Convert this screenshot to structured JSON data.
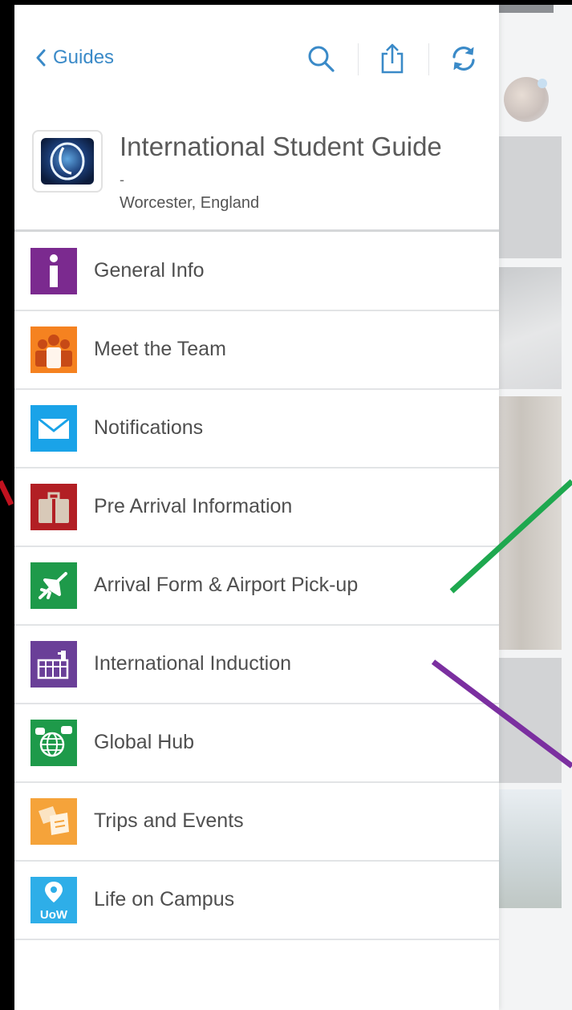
{
  "toolbar": {
    "back_label": "Guides",
    "search_icon": "search-icon",
    "share_icon": "share-icon",
    "refresh_icon": "refresh-icon",
    "accent_color": "#3a8ac8"
  },
  "guide": {
    "title": "International Student Guide",
    "dash": "-",
    "location": "Worcester, England"
  },
  "menu": {
    "items": [
      {
        "label": "General Info",
        "icon": "info-icon",
        "color": "#7b2a8f"
      },
      {
        "label": "Meet the Team",
        "icon": "team-icon",
        "color": "#f58220"
      },
      {
        "label": "Notifications",
        "icon": "mail-icon",
        "color": "#1aa3e8"
      },
      {
        "label": "Pre Arrival Information",
        "icon": "suitcase-icon",
        "color": "#b21f24"
      },
      {
        "label": "Arrival Form & Airport Pick-up",
        "icon": "airplane-icon",
        "color": "#1e9a4a"
      },
      {
        "label": "International Induction",
        "icon": "building-icon",
        "color": "#6a3f98"
      },
      {
        "label": "Global Hub",
        "icon": "globe-chat-icon",
        "color": "#1e9a4a"
      },
      {
        "label": "Trips and Events",
        "icon": "tickets-icon",
        "color": "#f5a33a"
      },
      {
        "label": "Life on Campus",
        "icon": "campus-pin-icon",
        "color": "#2eaee8",
        "badge": "UoW"
      }
    ]
  },
  "annotations": {
    "colors": [
      "#c1121f",
      "#1ea84f",
      "#7b2fa0"
    ]
  }
}
